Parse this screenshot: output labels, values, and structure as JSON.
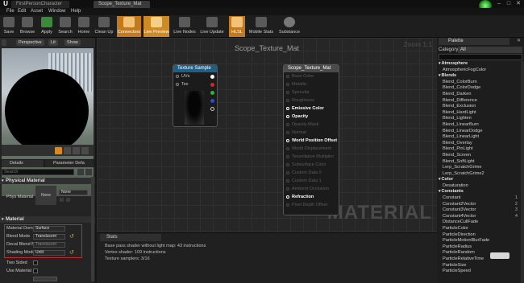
{
  "tabs": [
    "FirstPersonCharacter",
    "Scope_Texture_Mat"
  ],
  "menu": [
    "File",
    "Edit",
    "Asset",
    "Window",
    "Help"
  ],
  "toolbar": {
    "save": "Save",
    "browse": "Browse",
    "apply": "Apply",
    "search": "Search",
    "home": "Home",
    "clean_up": "Clean Up",
    "connectors": "Connectors",
    "live_preview": "Live Preview",
    "live_nodes": "Live Nodes",
    "live_update": "Live Update",
    "hlsl": "HLSL",
    "mobile_stats": "Mobile Stats",
    "substance": "Substance"
  },
  "viewport": {
    "perspective": "Perspective",
    "lit": "Lit",
    "show": "Show"
  },
  "details": {
    "tab_details": "Details",
    "tab_params": "Parameter Defa",
    "search_placeholder": "Search",
    "physical_material_section": "Physical Material",
    "phys_material_label": "Phys Material",
    "phys_material_thumb": "None",
    "phys_material_value": "None",
    "material_section": "Material",
    "props": {
      "domain_label": "Material Dom",
      "domain_value": "Surface",
      "blend_label": "Blend Mode",
      "blend_value": "Translucent",
      "decal_label": "Decal Blend M",
      "decal_value": "Translucent",
      "shading_label": "Shading Mode",
      "shading_value": "Unlit",
      "two_sided": "Two Sided",
      "use_material": "Use Material"
    }
  },
  "graph": {
    "title": "Scope_Texture_Mat",
    "zoom": "Zoom 1:1",
    "watermark": "MATERIAL",
    "texture_node": {
      "title": "Texture Sample",
      "inputs": [
        "UVs",
        "Tex"
      ]
    },
    "material_node": {
      "title": "Scope_Texture_Mat",
      "pins": [
        {
          "label": "Base Color",
          "active": false
        },
        {
          "label": "Metallic",
          "active": false
        },
        {
          "label": "Specular",
          "active": false
        },
        {
          "label": "Roughness",
          "active": false
        },
        {
          "label": "Emissive Color",
          "active": true
        },
        {
          "label": "Opacity",
          "active": true
        },
        {
          "label": "Opacity Mask",
          "active": false
        },
        {
          "label": "Normal",
          "active": false
        },
        {
          "label": "World Position Offset",
          "active": true
        },
        {
          "label": "World Displacement",
          "active": false
        },
        {
          "label": "Tessellation Multiplier",
          "active": false
        },
        {
          "label": "Subsurface Color",
          "active": false
        },
        {
          "label": "Custom Data 0",
          "active": false
        },
        {
          "label": "Custom Data 1",
          "active": false
        },
        {
          "label": "Ambient Occlusion",
          "active": false
        },
        {
          "label": "Refraction",
          "active": true
        },
        {
          "label": "Pixel Depth Offset",
          "active": false
        }
      ]
    }
  },
  "stats": {
    "tab": "Stats",
    "lines": [
      "Base pass shader without light map: 43 instructions",
      "Vertex shader: 109 instructions",
      "Texture samplers: 3/16"
    ]
  },
  "palette": {
    "tab": "Palette",
    "category_label": "Category",
    "category_value": "All",
    "tooltip": "",
    "items": [
      {
        "type": "cat",
        "label": "Atmosphere"
      },
      {
        "type": "leaf",
        "label": "AtmosphericFogColor"
      },
      {
        "type": "cat",
        "label": "Blends"
      },
      {
        "type": "leaf",
        "label": "Blend_ColorBurn"
      },
      {
        "type": "leaf",
        "label": "Blend_ColorDodge"
      },
      {
        "type": "leaf",
        "label": "Blend_Darken"
      },
      {
        "type": "leaf",
        "label": "Blend_Difference"
      },
      {
        "type": "leaf",
        "label": "Blend_Exclusion"
      },
      {
        "type": "leaf",
        "label": "Blend_HardLight"
      },
      {
        "type": "leaf",
        "label": "Blend_Lighten"
      },
      {
        "type": "leaf",
        "label": "Blend_LinearBurn"
      },
      {
        "type": "leaf",
        "label": "Blend_LinearDodge"
      },
      {
        "type": "leaf",
        "label": "Blend_LinearLight"
      },
      {
        "type": "leaf",
        "label": "Blend_Overlay"
      },
      {
        "type": "leaf",
        "label": "Blend_PinLight"
      },
      {
        "type": "leaf",
        "label": "Blend_Screen"
      },
      {
        "type": "leaf",
        "label": "Blend_SoftLight"
      },
      {
        "type": "leaf",
        "label": "Lerp_ScratchGrime"
      },
      {
        "type": "leaf",
        "label": "Lerp_ScratchGrime2"
      },
      {
        "type": "cat",
        "label": "Color"
      },
      {
        "type": "leaf",
        "label": "Desaturation"
      },
      {
        "type": "cat",
        "label": "Constants"
      },
      {
        "type": "leaf",
        "label": "Constant",
        "hotkey": "1"
      },
      {
        "type": "leaf",
        "label": "Constant2Vector",
        "hotkey": "2"
      },
      {
        "type": "leaf",
        "label": "Constant3Vector",
        "hotkey": "3"
      },
      {
        "type": "leaf",
        "label": "Constant4Vector",
        "hotkey": "4"
      },
      {
        "type": "leaf",
        "label": "DistanceCullFade"
      },
      {
        "type": "leaf",
        "label": "ParticleColor"
      },
      {
        "type": "leaf",
        "label": "ParticleDirection"
      },
      {
        "type": "leaf",
        "label": "ParticleMotionBlurFade"
      },
      {
        "type": "leaf",
        "label": "ParticleRadius"
      },
      {
        "type": "leaf",
        "label": "ParticleRandom"
      },
      {
        "type": "leaf",
        "label": "ParticleRelativeTime"
      },
      {
        "type": "leaf",
        "label": "ParticleSize"
      },
      {
        "type": "leaf",
        "label": "ParticleSpeed"
      }
    ]
  },
  "colors": {
    "accent_orange": "#c37a1a",
    "node_texture_header": "#1f5f86",
    "node_material_header": "#4a4a4a",
    "pin_white": "#ffffff",
    "pin_red": "#e02020",
    "pin_green": "#20c020",
    "pin_blue": "#2050e0",
    "property_box": "#c62828"
  }
}
